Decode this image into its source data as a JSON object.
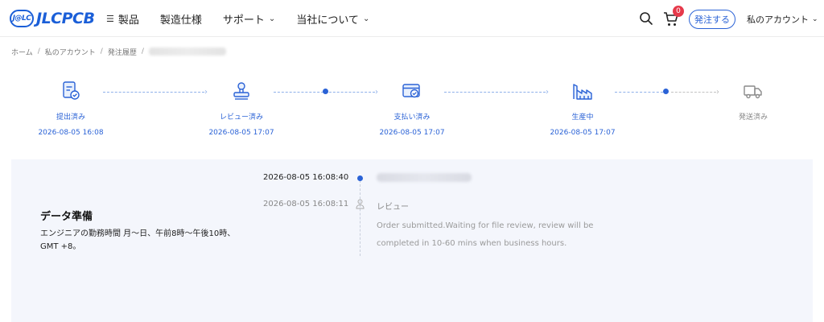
{
  "header": {
    "logo_badge": "J@LC",
    "logo_text": "JLCPCB",
    "nav": [
      {
        "label": "製品"
      },
      {
        "label": "製造仕様"
      },
      {
        "label": "サポート"
      },
      {
        "label": "当社について"
      }
    ],
    "cart_count": "0",
    "order_button": "発注する",
    "account_label": "私のアカウント"
  },
  "breadcrumb": {
    "items": [
      "ホーム",
      "私のアカウント",
      "発注履歴"
    ],
    "separator": "/"
  },
  "stepper": {
    "steps": [
      {
        "label": "提出済み",
        "date": "2026-08-05 16:08",
        "icon": "document-check-icon",
        "status": "done"
      },
      {
        "label": "レビュー済み",
        "date": "2026-08-05 17:07",
        "icon": "stamp-icon",
        "status": "done"
      },
      {
        "label": "支払い済み",
        "date": "2026-08-05 17:07",
        "icon": "payment-card-icon",
        "status": "done"
      },
      {
        "label": "生産中",
        "date": "2026-08-05 17:07",
        "icon": "factory-icon",
        "status": "done"
      },
      {
        "label": "発送済み",
        "date": "",
        "icon": "truck-icon",
        "status": "pending"
      }
    ],
    "colors": {
      "active": "#2a62d6",
      "pending": "#888888"
    }
  },
  "panel": {
    "title": "データ準備",
    "description": "エンジニアの勤務時間 月～日、午前8時～午後10時、GMT +8。",
    "timeline": [
      {
        "time": "2026-08-05 16:08:40"
      },
      {
        "time": "2026-08-05 16:08:11",
        "label": "レビュー",
        "message": "Order submitted.Waiting for file review, review will be completed in 10-60 mins when business hours."
      }
    ]
  }
}
